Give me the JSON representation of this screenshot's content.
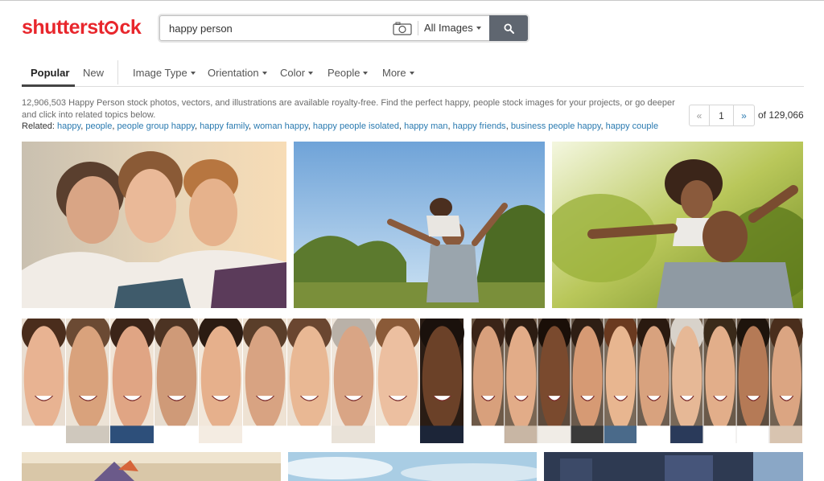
{
  "header": {
    "logo_text_a": "shutterst",
    "logo_text_b": "ck",
    "search": {
      "value": "happy person",
      "type_label": "All Images"
    }
  },
  "nav": {
    "items": [
      {
        "label": "Popular"
      },
      {
        "label": "New"
      },
      {
        "label": "Image Type"
      },
      {
        "label": "Orientation"
      },
      {
        "label": "Color"
      },
      {
        "label": "People"
      },
      {
        "label": "More"
      }
    ]
  },
  "results": {
    "summary": "12,906,503 Happy Person stock photos, vectors, and illustrations are available royalty-free. Find the perfect happy, people stock images for your projects, or go deeper and click into related topics below.",
    "related_label": "Related:",
    "related": [
      "happy",
      "people",
      "people group happy",
      "happy family",
      "woman happy",
      "happy people isolated",
      "happy man",
      "happy friends",
      "business people happy",
      "happy couple"
    ]
  },
  "pagination": {
    "prev": "«",
    "page": "1",
    "next": "»",
    "total": "of 129,066"
  },
  "icons": {
    "camera": "camera-icon",
    "search": "search-icon"
  },
  "colors": {
    "brand": "#e8262c",
    "link": "#2a7ab0",
    "search_button": "#5f6670"
  }
}
